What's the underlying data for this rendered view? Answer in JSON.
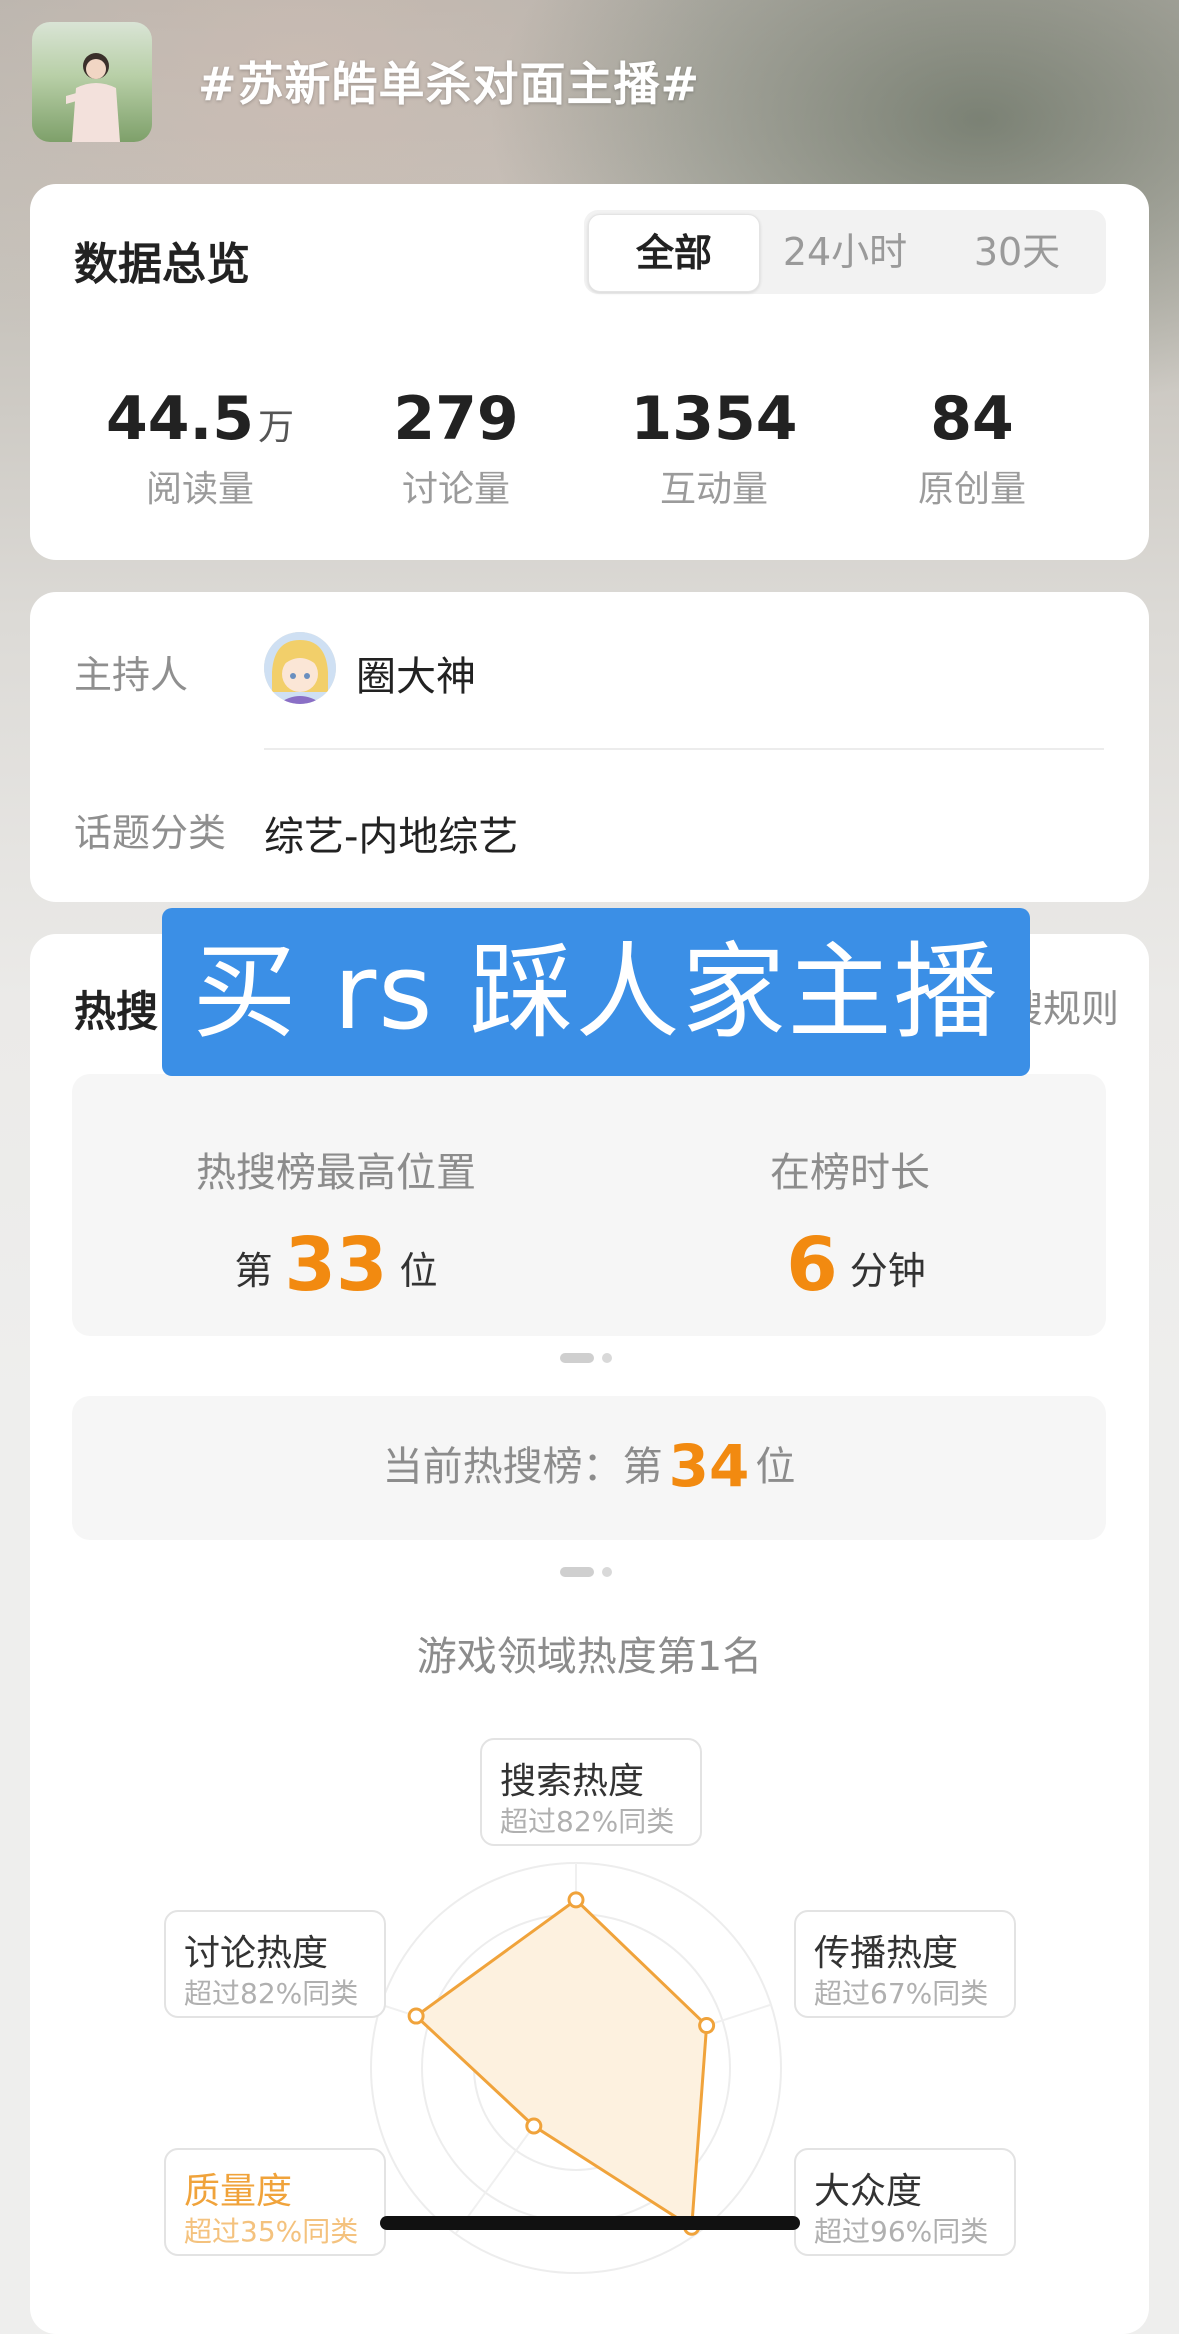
{
  "header": {
    "topic_title": "#苏新皓单杀对面主播#"
  },
  "overview": {
    "title": "数据总览",
    "tabs": [
      {
        "label": "全部",
        "active": true
      },
      {
        "label": "24小时",
        "active": false
      },
      {
        "label": "30天",
        "active": false
      }
    ],
    "stats": [
      {
        "value": "44.5",
        "unit": "万",
        "label": "阅读量"
      },
      {
        "value": "279",
        "unit": "",
        "label": "讨论量"
      },
      {
        "value": "1354",
        "unit": "",
        "label": "互动量"
      },
      {
        "value": "84",
        "unit": "",
        "label": "原创量"
      }
    ]
  },
  "info": {
    "host_label": "主持人",
    "host_name": "圈大神",
    "category_label": "话题分类",
    "category_value": "综艺-内地综艺"
  },
  "hot": {
    "title": "热搜",
    "rule_link": "搜规则",
    "overlay_caption": "买 rs 踩人家主播",
    "peak_label": "热搜榜最高位置",
    "peak_prefix": "第",
    "peak_rank": "33",
    "peak_suffix": "位",
    "duration_label": "在榜时长",
    "duration_value": "6",
    "duration_unit": "分钟",
    "current_prefix": "当前热搜榜：第",
    "current_rank": "34",
    "current_suffix": "位",
    "domain_rank": "游戏领域热度第1名"
  },
  "radar": {
    "metrics": [
      {
        "name": "搜索热度",
        "note": "超过82%同类",
        "percent": 82,
        "highlight": false
      },
      {
        "name": "传播热度",
        "note": "超过67%同类",
        "percent": 67,
        "highlight": false
      },
      {
        "name": "大众度",
        "note": "超过96%同类",
        "percent": 96,
        "highlight": false
      },
      {
        "name": "质量度",
        "note": "超过35%同类",
        "percent": 35,
        "highlight": true
      },
      {
        "name": "讨论热度",
        "note": "超过82%同类",
        "percent": 82,
        "highlight": false
      }
    ],
    "line_color": "#f0a33b",
    "fill_color": "#fdf1df"
  }
}
